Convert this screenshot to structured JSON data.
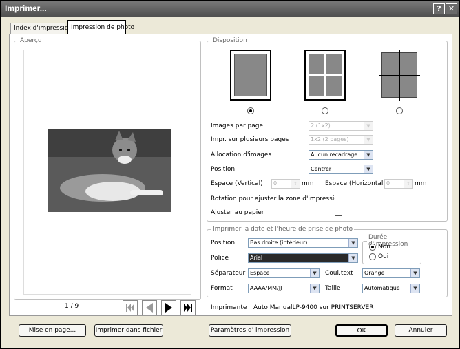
{
  "window": {
    "title": "Imprimer...",
    "help_icon": "?",
    "close_icon": "✕"
  },
  "tabs": [
    {
      "label": "Index d'impression"
    },
    {
      "label": "Impression de photo"
    }
  ],
  "preview": {
    "legend": "Aperçu",
    "page_counter": "1 / 9"
  },
  "disposition": {
    "legend": "Disposition",
    "selected_layout": 0,
    "rows": [
      {
        "label": "Images par page",
        "value": "2 (1x2)",
        "disabled": true
      },
      {
        "label": "Impr. sur plusieurs pages",
        "value": "1x2 (2 pages)",
        "disabled": true
      },
      {
        "label": "Allocation d'images",
        "value": "Aucun recadrage",
        "disabled": false
      },
      {
        "label": "Position",
        "value": "Centrer",
        "disabled": false
      }
    ],
    "space_v_label": "Espace (Vertical)",
    "space_v_value": "0",
    "space_h_label": "Espace (Horizontal)",
    "space_h_value": "0",
    "unit": "mm",
    "rotate_label": "Rotation pour ajuster la zone d'impression",
    "fit_label": "Ajuster au papier"
  },
  "date": {
    "legend": "Imprimer la date et l'heure de prise de photo",
    "position_label": "Position",
    "position_value": "Bas droite (intérieur)",
    "police_label": "Police",
    "police_value": "Arial",
    "separator_label": "Séparateur",
    "separator_value": "Espace",
    "couleur_label": "Coul.text",
    "couleur_value": "Orange",
    "format_label": "Format",
    "format_value": "AAAA/MM/JJ",
    "taille_label": "Taille",
    "taille_value": "Automatique",
    "duree_legend": "Durée d'impression",
    "duree_non": "Non",
    "duree_oui": "Oui"
  },
  "printer": {
    "label": "Imprimante",
    "value": "Auto ManualLP-9400 sur PRINTSERVER"
  },
  "buttons": {
    "mise_en_page": "Mise en page...",
    "imprimer_fichier": "Imprimer dans fichier",
    "parametres": "Paramètres d' impression",
    "ok": "OK",
    "annuler": "Annuler"
  }
}
